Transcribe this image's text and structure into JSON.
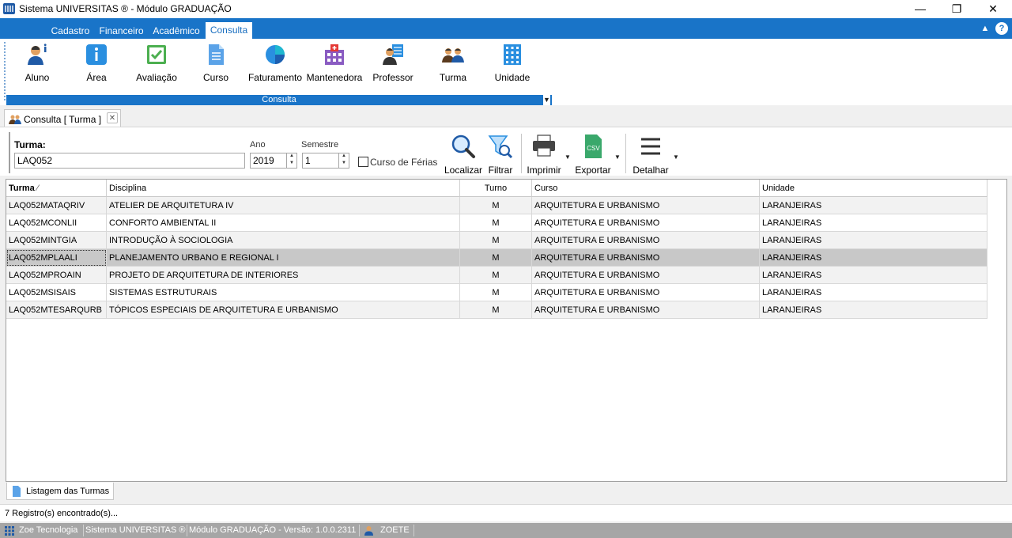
{
  "window": {
    "title": "Sistema UNIVERSITAS ® - Módulo GRADUAÇÃO",
    "minimize": "—",
    "restore": "❐",
    "close": "✕"
  },
  "ribbon": {
    "tabs": [
      "Cadastro",
      "Financeiro",
      "Acadêmico",
      "Consulta"
    ],
    "active_tab": "Consulta",
    "collapse_glyph": "▲",
    "help_glyph": "?",
    "buttons": [
      {
        "label": "Aluno",
        "icon": "student-icon"
      },
      {
        "label": "Área",
        "icon": "info-icon"
      },
      {
        "label": "Avaliação",
        "icon": "checkbox-icon"
      },
      {
        "label": "Curso",
        "icon": "document-icon"
      },
      {
        "label": "Faturamento",
        "icon": "pie-chart-icon"
      },
      {
        "label": "Mantenedora",
        "icon": "hospital-building-icon"
      },
      {
        "label": "Professor",
        "icon": "teacher-icon"
      },
      {
        "label": "Turma",
        "icon": "group-icon"
      },
      {
        "label": "Unidade",
        "icon": "building-icon"
      }
    ],
    "group_label": "Consulta"
  },
  "doc_tab": {
    "label": "Consulta [ Turma ]",
    "close_glyph": "✕"
  },
  "filter": {
    "turma_label": "Turma:",
    "turma_value": "LAQ052",
    "ano_label": "Ano",
    "ano_value": "2019",
    "semestre_label": "Semestre",
    "semestre_value": "1",
    "ferias_label": "Curso de Férias",
    "ferias_checked": false
  },
  "toolbar": {
    "localizar": "Localizar",
    "filtrar": "Filtrar",
    "imprimir": "Imprimir",
    "exportar": "Exportar",
    "detalhar": "Detalhar",
    "csv_text": "CSV",
    "dropdown_glyph": "▼"
  },
  "grid": {
    "columns": [
      "Turma",
      "Disciplina",
      "Turno",
      "Curso",
      "Unidade"
    ],
    "sort_glyph": "⁄",
    "rows": [
      [
        "LAQ052MATAQRIV",
        "ATELIER DE ARQUITETURA IV",
        "M",
        "ARQUITETURA E URBANISMO",
        "LARANJEIRAS"
      ],
      [
        "LAQ052MCONLII",
        "CONFORTO AMBIENTAL II",
        "M",
        "ARQUITETURA E URBANISMO",
        "LARANJEIRAS"
      ],
      [
        "LAQ052MINTGIA",
        "INTRODUÇÃO À SOCIOLOGIA",
        "M",
        "ARQUITETURA E URBANISMO",
        "LARANJEIRAS"
      ],
      [
        "LAQ052MPLAALI",
        "PLANEJAMENTO URBANO E REGIONAL I",
        "M",
        "ARQUITETURA E URBANISMO",
        "LARANJEIRAS"
      ],
      [
        "LAQ052MPROAIN",
        "PROJETO DE ARQUITETURA DE INTERIORES",
        "M",
        "ARQUITETURA E URBANISMO",
        "LARANJEIRAS"
      ],
      [
        "LAQ052MSISAIS",
        "SISTEMAS ESTRUTURAIS",
        "M",
        "ARQUITETURA E URBANISMO",
        "LARANJEIRAS"
      ],
      [
        "LAQ052MTESARQURB",
        "TÓPICOS ESPECIAIS DE ARQUITETURA E URBANISMO",
        "M",
        "ARQUITETURA E URBANISMO",
        "LARANJEIRAS"
      ]
    ],
    "selected_row": 3
  },
  "list_tab": {
    "label": "Listagem das Turmas"
  },
  "records": {
    "text": "7 Registro(s) encontrado(s)..."
  },
  "statusbar": {
    "company": "Zoe Tecnologia",
    "system": "Sistema UNIVERSITAS ®",
    "module": "Módulo GRADUAÇÃO - Versão: 1.0.0.2311",
    "user": "ZOETE"
  },
  "colors": {
    "accent": "#1974c8",
    "selected_row": "#c8c8c8",
    "status_bar": "#a6a6a6"
  }
}
